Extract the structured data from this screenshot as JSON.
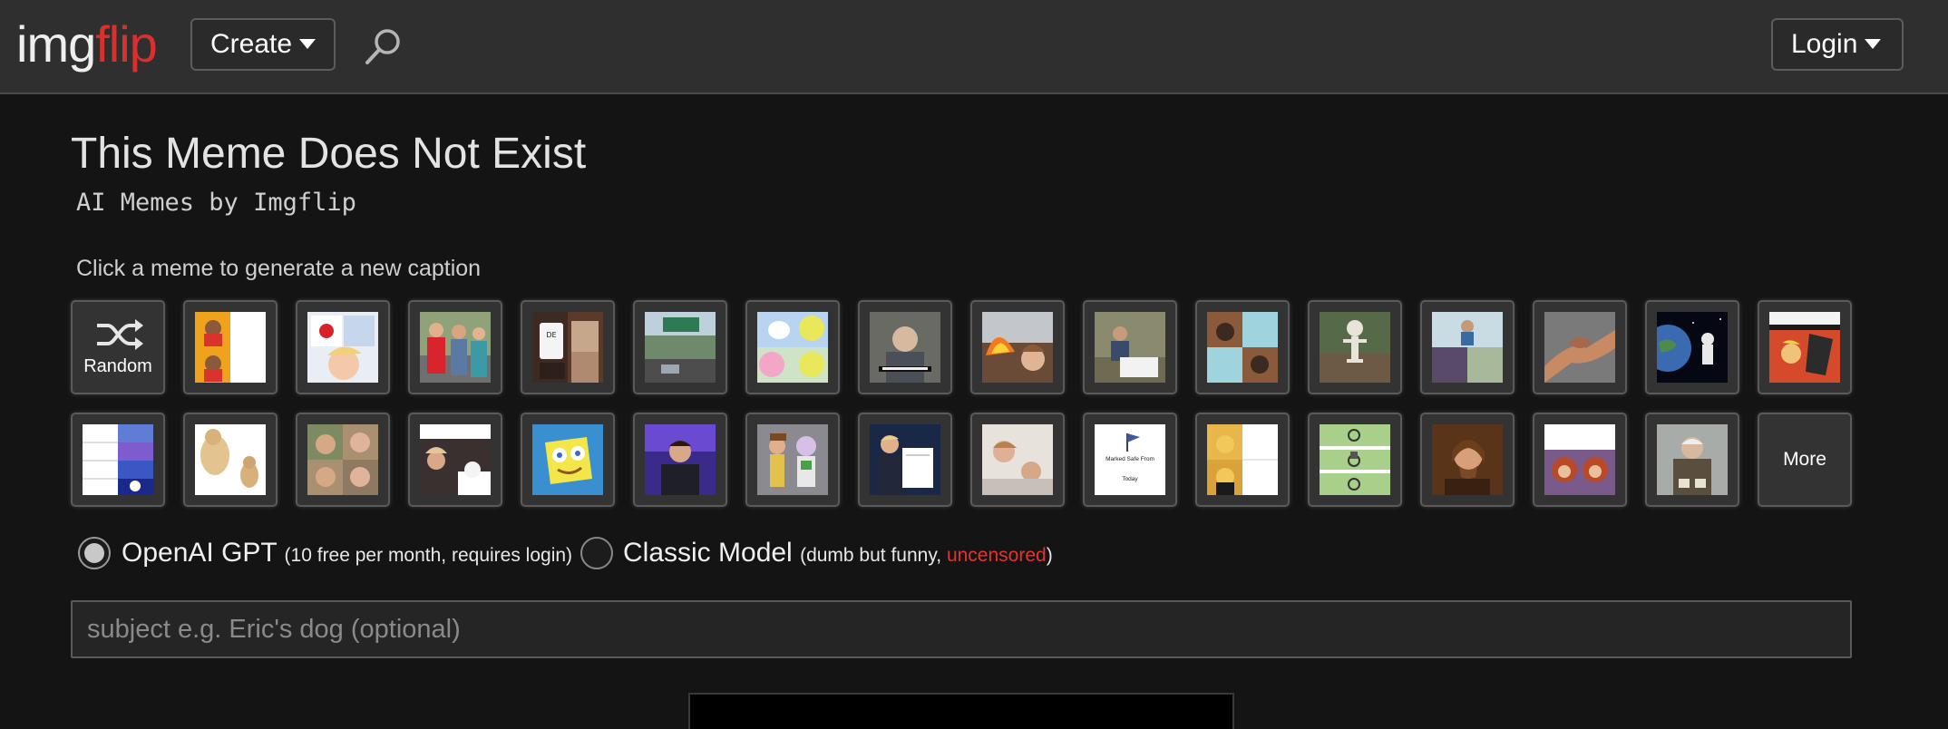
{
  "header": {
    "logo_part1": "img",
    "logo_part2": "flip",
    "logo_color_main": "#eeeeee",
    "logo_color_accent": "#d8302f",
    "create_label": "Create",
    "login_label": "Login",
    "search_icon": "search-icon"
  },
  "page": {
    "title": "This Meme Does Not Exist",
    "subtitle": "AI Memes by Imgflip",
    "instruction": "Click a meme to generate a new caption"
  },
  "templates": {
    "random_label": "Random",
    "more_label": "More",
    "row1_count_thumbs": 15,
    "row2_count_thumbs": 15
  },
  "models": {
    "openai_label": "OpenAI GPT",
    "openai_note": "(10 free per month, requires login)",
    "openai_selected": true,
    "classic_label": "Classic Model",
    "classic_note_pre": "(dumb but funny, ",
    "classic_note_red": "uncensored",
    "classic_note_post": ")",
    "classic_selected": false,
    "accent_red": "#e5322e"
  },
  "subject": {
    "placeholder": "subject e.g. Eric's dog (optional)",
    "value": ""
  },
  "thumb_texts": {
    "marked_safe": "Marked Safe From",
    "today": "Today"
  }
}
